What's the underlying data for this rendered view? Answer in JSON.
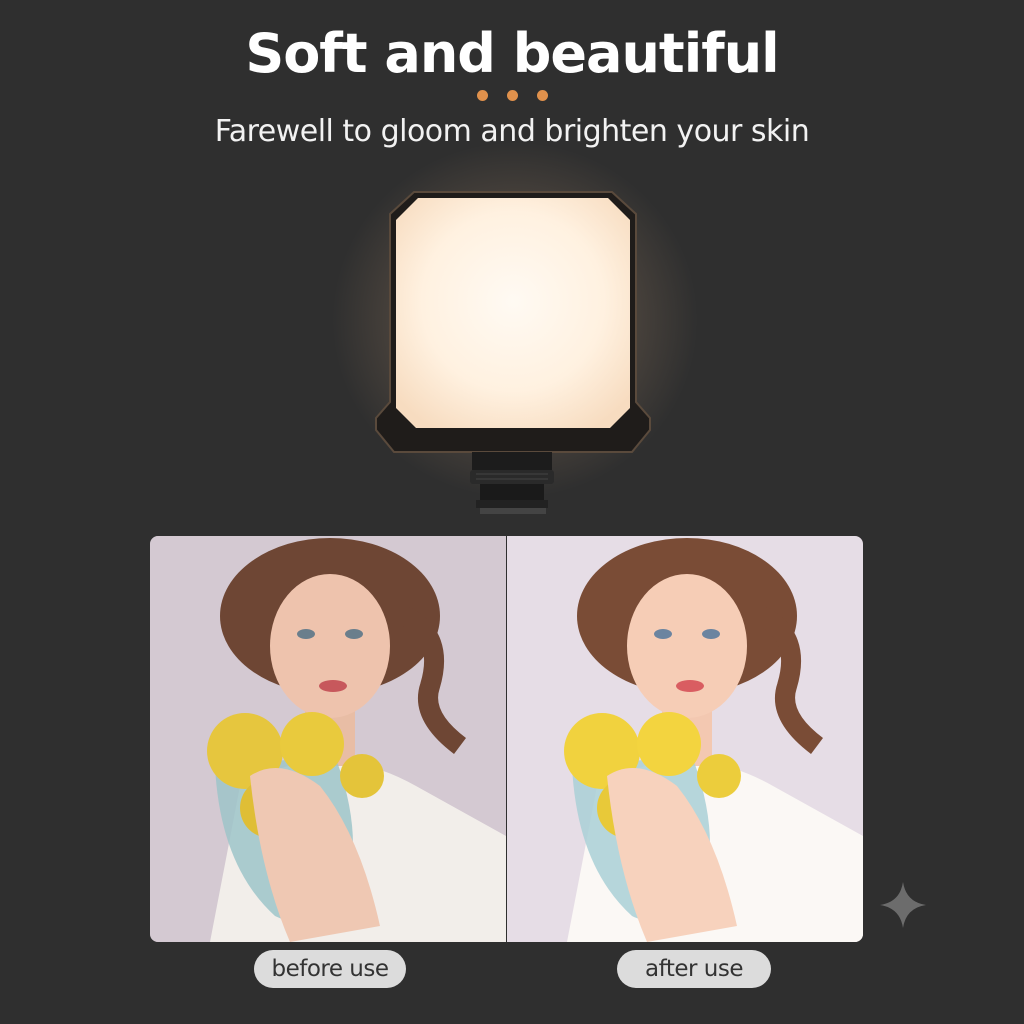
{
  "header": {
    "title": "Soft and beautiful",
    "subtitle": "Farewell to gloom and brighten your skin"
  },
  "comparison": {
    "before_label": "before use",
    "after_label": "after use"
  },
  "colors": {
    "background": "#2f2f2f",
    "accent_dots": "#e0914c",
    "light_panel": "#fff3e4",
    "label_pill": "#dcdcdc"
  },
  "icons": [
    "decorative-dots-icon",
    "sparkle-icon"
  ]
}
